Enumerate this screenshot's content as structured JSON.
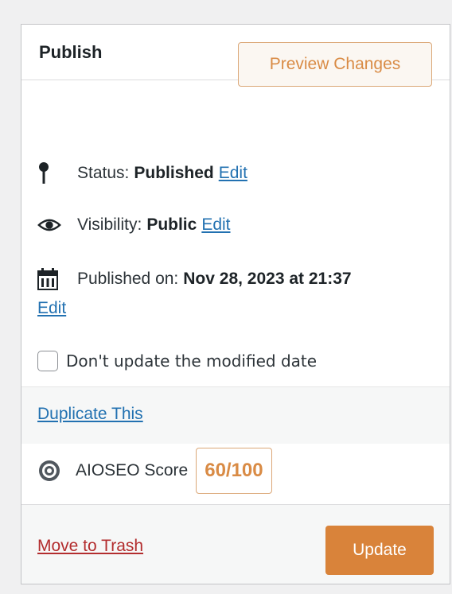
{
  "panel": {
    "title": "Publish",
    "controls": [
      {
        "icon": "chevron-up-icon"
      },
      {
        "icon": "chevron-down-icon"
      },
      {
        "icon": "caret-up-icon"
      }
    ]
  },
  "actions": {
    "preview_label": "Preview Changes"
  },
  "status": {
    "icon": "pin-icon",
    "label": "Status:",
    "value": "Published",
    "edit": "Edit"
  },
  "visibility": {
    "icon": "eye-icon",
    "label": "Visibility:",
    "value": "Public",
    "edit": "Edit"
  },
  "published_on": {
    "icon": "calendar-icon",
    "label": "Published on:",
    "value": "Nov 28, 2023 at 21:37",
    "edit": "Edit"
  },
  "modified_date": {
    "label": "Don't update the modified date",
    "checked": false
  },
  "duplicate": {
    "label": "Duplicate This"
  },
  "aioseo": {
    "icon": "aioseo-gear-icon",
    "label": "AIOSEO Score",
    "score": "60/100",
    "color": "#d98b45"
  },
  "footer": {
    "trash_label": "Move to Trash",
    "update_label": "Update",
    "update_color": "#d9833a"
  }
}
